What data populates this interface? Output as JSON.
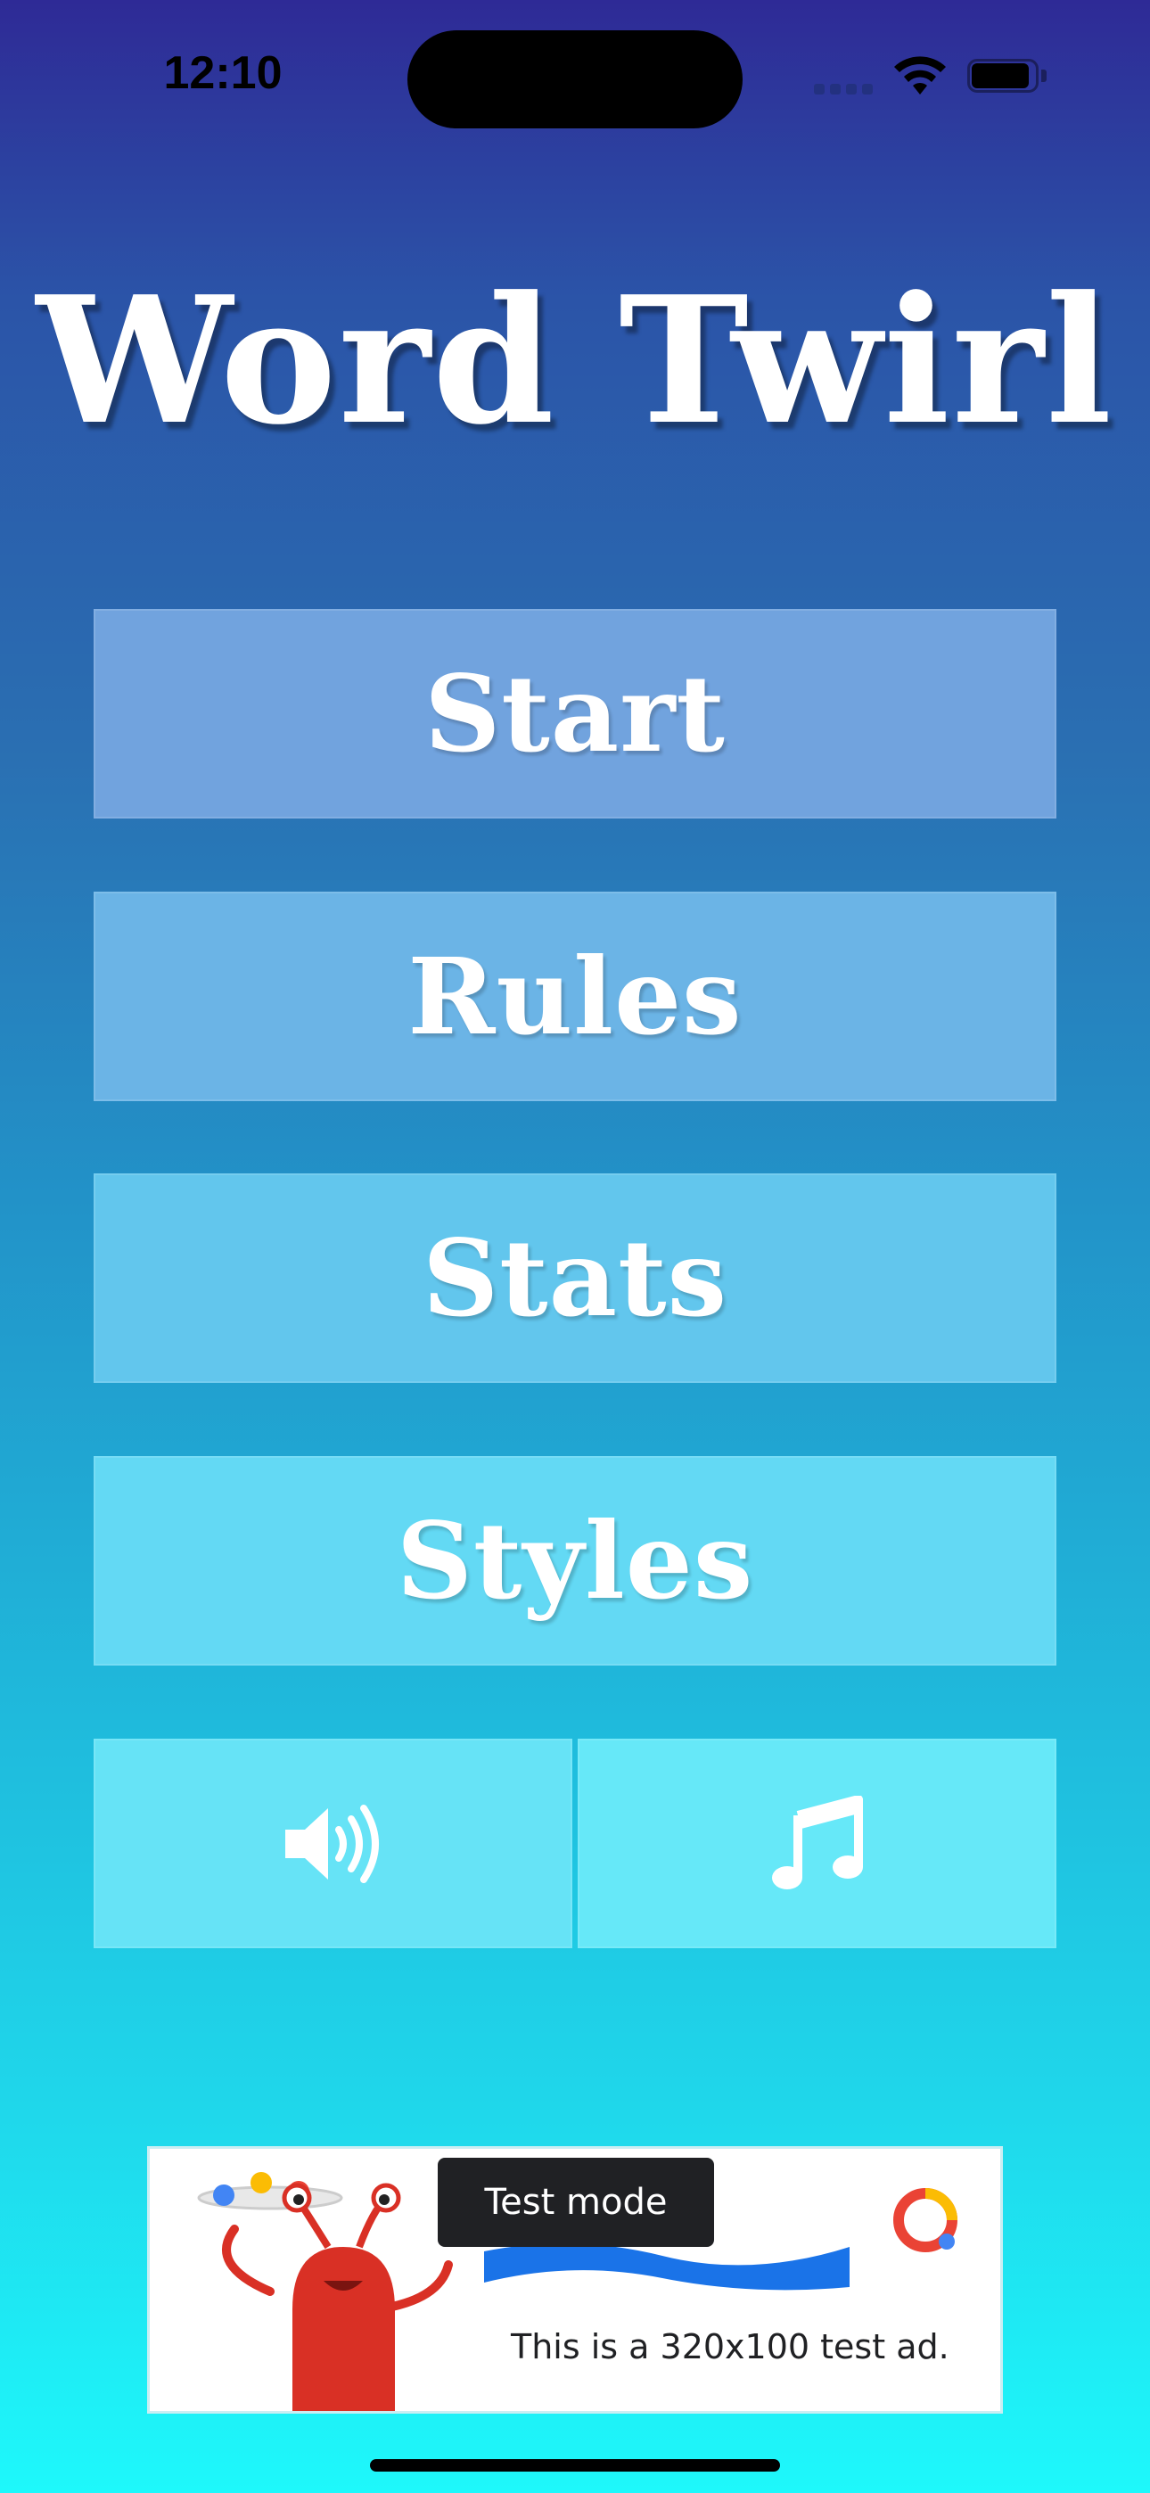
{
  "status_bar": {
    "time": "12:10",
    "icons": [
      "signal-icon",
      "wifi-icon",
      "battery-icon"
    ]
  },
  "app": {
    "title": "Word Twirl"
  },
  "menu": {
    "start_label": "Start",
    "rules_label": "Rules",
    "stats_label": "Stats",
    "styles_label": "Styles",
    "sound_icon": "speaker-icon",
    "music_icon": "music-note-icon"
  },
  "ad": {
    "badge": "Test mode",
    "text": "This is a 320x100 test ad."
  },
  "colors": {
    "gradient_top": "#2e2a96",
    "gradient_bottom": "#1ef8fb",
    "title_text": "#ffffff",
    "ad_badge_bg": "#202124"
  }
}
